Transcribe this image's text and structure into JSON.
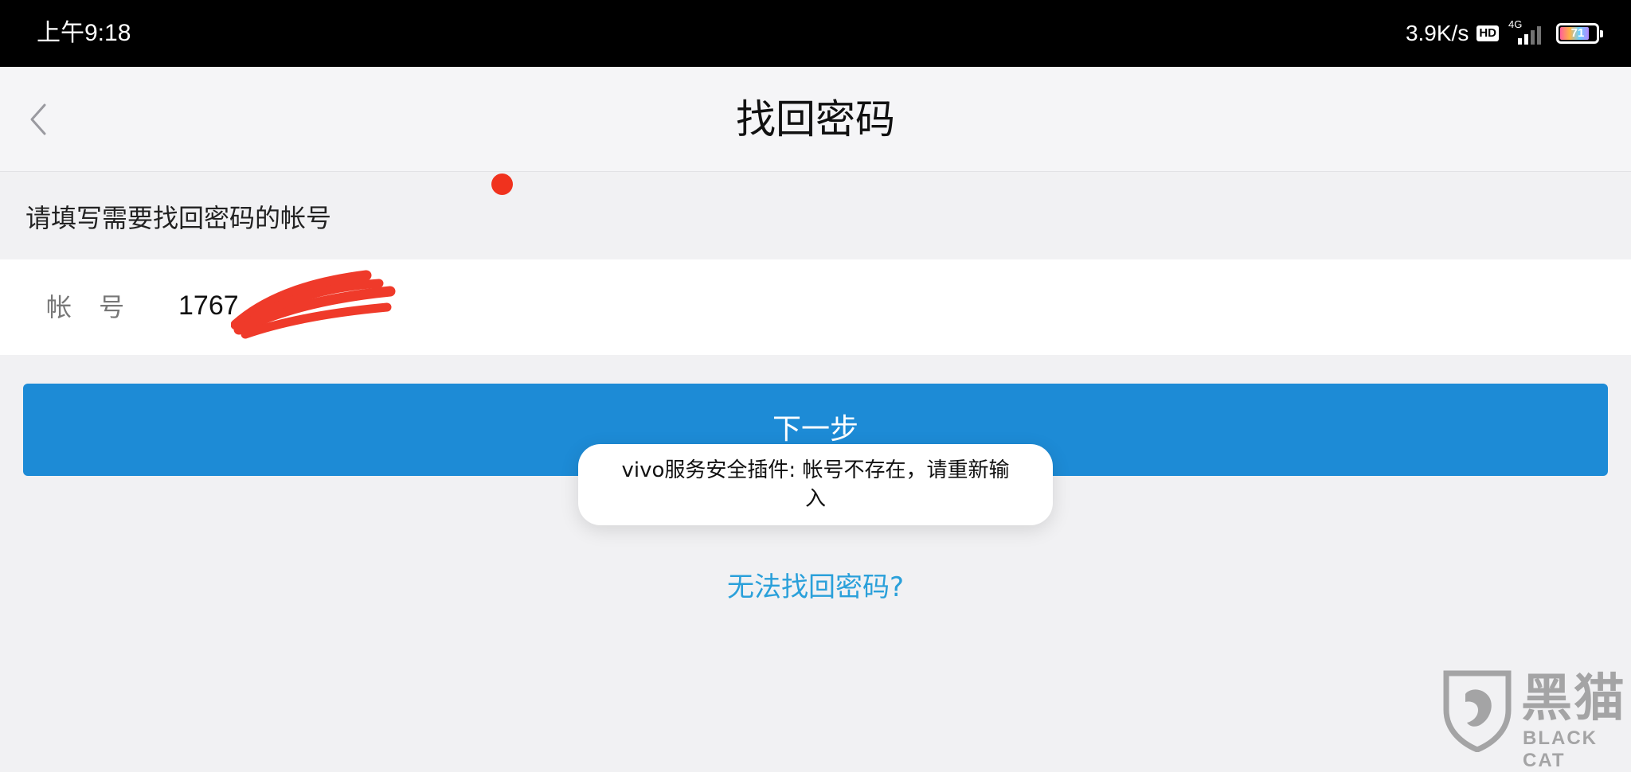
{
  "status_bar": {
    "time": "上午9:18",
    "network_speed": "3.9K/s",
    "hd_badge": "HD",
    "network_type": "4G",
    "battery_level": "71",
    "icons": [
      "hd-icon",
      "signal-icon",
      "battery-icon"
    ]
  },
  "header": {
    "title": "找回密码",
    "back_icon": "chevron-left-icon"
  },
  "form": {
    "instruction": "请填写需要找回密码的帐号",
    "account_label": "帐 号",
    "account_value": "1767"
  },
  "actions": {
    "next_label": "下一步",
    "recover_link": "无法找回密码?"
  },
  "toast": {
    "message": "vivo服务安全插件: 帐号不存在，请重新输入"
  },
  "watermark": {
    "name_cn": "黑猫",
    "name_en": "BLACK CAT"
  },
  "colors": {
    "primary_button": "#1d8bd6",
    "link": "#2aa0da",
    "background": "#f1f1f3",
    "status_bar": "#000000",
    "notification_dot": "#f0321e",
    "redaction": "#ef3a2a"
  }
}
